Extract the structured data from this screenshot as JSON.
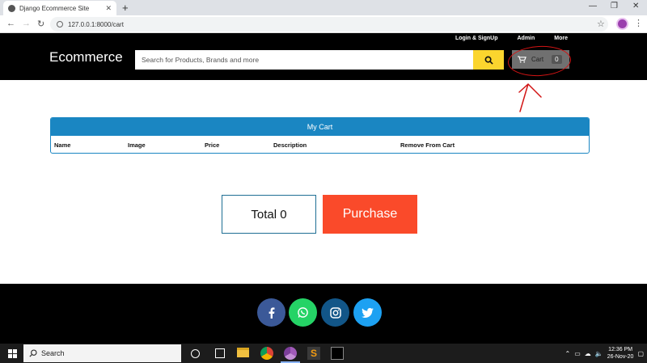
{
  "browser": {
    "tab_title": "Django Ecommerce Site",
    "tab_close": "✕",
    "new_tab": "+",
    "url": "127.0.0.1:8000/cart",
    "window_controls": [
      "—",
      "❐",
      "✕"
    ]
  },
  "header": {
    "brand": "Ecommerce",
    "links": [
      "Login & SignUp",
      "Admin",
      "More"
    ],
    "search_placeholder": "Search for Products, Brands and more",
    "cart_label": "Cart",
    "cart_count": "0"
  },
  "cart": {
    "title": "My Cart",
    "columns": [
      "Name",
      "Image",
      "Price",
      "Description",
      "Remove From Cart"
    ]
  },
  "summary": {
    "total_label": "Total 0",
    "purchase_label": "Purchase"
  },
  "footer": {
    "social_icons": [
      "facebook-icon",
      "whatsapp-icon",
      "instagram-icon",
      "twitter-icon"
    ],
    "colors": {
      "facebook": "#3b5998",
      "whatsapp": "#25d366",
      "instagram": "#125688",
      "twitter": "#1da1f2"
    }
  },
  "taskbar": {
    "search_label": "Search",
    "time": "12:36 PM",
    "date": "26-Nov-20"
  },
  "colors": {
    "header_bg": "#000000",
    "search_button": "#fbd52e",
    "cart_header": "#1a86c2",
    "purchase_button": "#fa4a2a",
    "annotation": "#d21414"
  }
}
